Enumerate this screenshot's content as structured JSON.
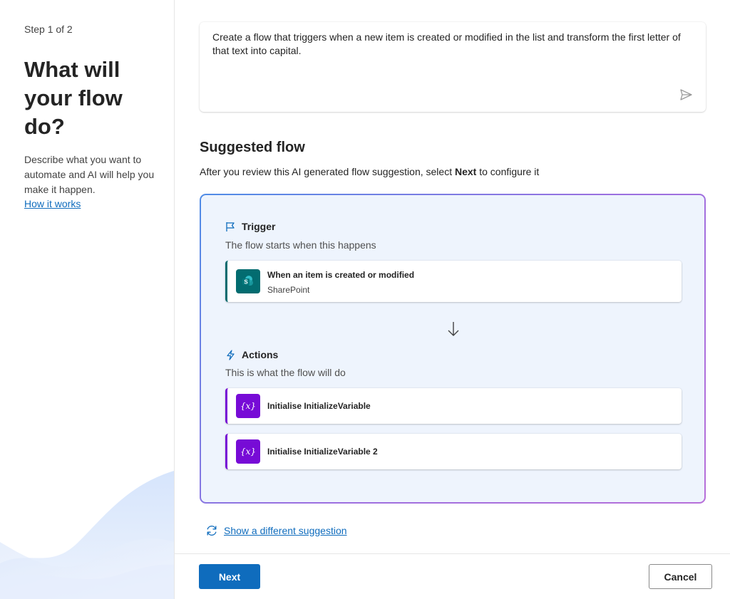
{
  "left_panel": {
    "step_label": "Step 1 of 2",
    "title": "What will your flow do?",
    "description": "Describe what you want to automate and AI will help you make it happen.",
    "how_it_works_link": "How it works"
  },
  "prompt": {
    "text": "Create a flow that triggers when a new item is created or modified in the list and transform the first letter of that text into capital.",
    "send_icon": "send-icon"
  },
  "suggested_flow": {
    "title": "Suggested flow",
    "subtitle_before": "After you review this AI generated flow suggestion, select ",
    "subtitle_bold": "Next",
    "subtitle_after": " to configure it",
    "trigger": {
      "heading": "Trigger",
      "subtitle": "The flow starts when this happens",
      "card_title": "When an item is created or modified",
      "card_subtitle": "SharePoint",
      "icon": "sharepoint-icon",
      "accent": "#036c70"
    },
    "actions": {
      "heading": "Actions",
      "subtitle": "This is what the flow will do",
      "items": [
        {
          "title": "Initialise InitializeVariable",
          "icon": "variable-icon",
          "icon_text": "{x}"
        },
        {
          "title": "Initialise InitializeVariable 2",
          "icon": "variable-icon",
          "icon_text": "{x}"
        }
      ],
      "accent": "#770bd6"
    }
  },
  "alt_suggestion_link": "Show a different suggestion",
  "footer": {
    "next_label": "Next",
    "cancel_label": "Cancel"
  },
  "colors": {
    "primary": "#0f6cbd",
    "sharepoint": "#036c70",
    "variable": "#770bd6"
  }
}
